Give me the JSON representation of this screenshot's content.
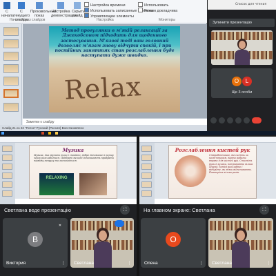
{
  "top": {
    "ribbon": {
      "buttons": [
        "С начала",
        "С текущего слайда",
        "Произвольный показ",
        "Настройка демонстрации",
        "Скрыть слайд"
      ],
      "checks": [
        {
          "label": "Настройка времени",
          "on": false
        },
        {
          "label": "Использовать записанные времена",
          "on": true
        },
        {
          "label": "Управляющие элементы",
          "on": true
        }
      ],
      "checks_right": [
        "Использовать",
        "Режим докладчика"
      ],
      "groups": [
        "Начать показ слайдов",
        "Настройка",
        "Мониторы"
      ],
      "right_label": "Список для чтения"
    },
    "slide": {
      "text": "Метод прогулянки в м'якій релаксації за Джекобсоном підходить для щоденного застосування. М'язові тоді ваш головний дозволяє м'язам знову відчути спокій, і при постійних заняттях стан розслаблення буде наступати дуже швидко.",
      "word": "Relax"
    },
    "notes_placeholder": "Заметки к слайду",
    "status": "Слайд 21 из 22   \"Поток\"   Русский (Россия)   Восстановлено",
    "meet": {
      "banner": "Зупинити презентацію",
      "others_label": "Ще 3 особи",
      "others_avatars": [
        "О",
        "L"
      ],
      "others_colors": [
        "#e8710a",
        "#d93025"
      ]
    }
  },
  "left": {
    "slide_title": "Музика",
    "slide_body": "Музика, яка звучить тихо і спокійно, добре допомагає в першу чергу розслабитися. Підібрані мелодії допомагають прибрати нервову напругу та заспокоїтися.",
    "slide_logo": "RELAXING",
    "presenting": "Светлана веде презентацію",
    "tiles": [
      {
        "name": "Виктория",
        "avatar": "В",
        "color": "#7c7d80"
      },
      {
        "name": "Светлана",
        "avatar": "",
        "color": ""
      }
    ]
  },
  "right": {
    "slide_title": "Розслаблення кистей рук",
    "slide_body": "Співробітникам, які сидять за комп'ютером, варто робити вправи для кистей рук. Стисніть руки в кулаки, потримайте кілька секунд, потім розслабте і відчуйте, як м'язи відпочивають. Повторіть кілька разів.",
    "presenting": "На главном экране: Светлана",
    "tiles": [
      {
        "name": "Олена",
        "avatar": "О",
        "color": "#e8491d"
      },
      {
        "name": "Светлана",
        "avatar": "",
        "color": ""
      }
    ]
  }
}
